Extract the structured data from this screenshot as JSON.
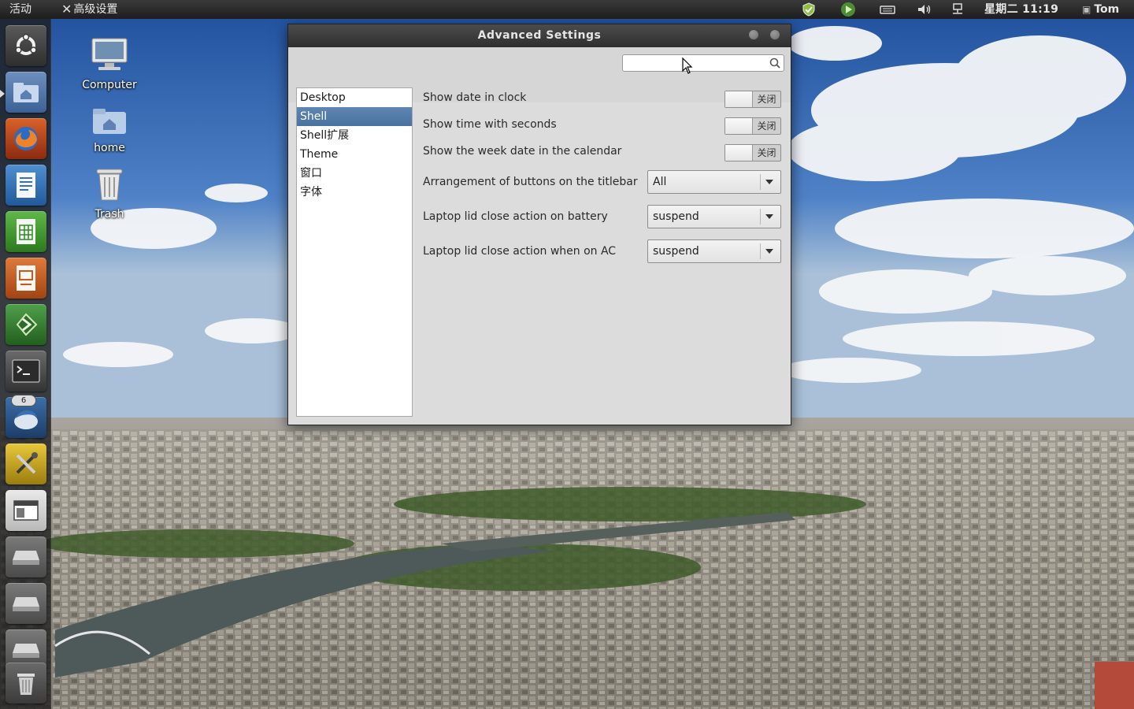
{
  "top_panel": {
    "activities": "活动",
    "app_menu": "高级设置",
    "clock": "星期二 11:19",
    "user": "Tom"
  },
  "launcher": {
    "items": [
      {
        "icon": "ubuntu-logo-icon"
      },
      {
        "icon": "home-folder-icon"
      },
      {
        "icon": "firefox-icon"
      },
      {
        "icon": "writer-icon"
      },
      {
        "icon": "calc-icon"
      },
      {
        "icon": "impress-icon"
      },
      {
        "icon": "gedit-icon"
      },
      {
        "icon": "terminal-icon"
      },
      {
        "icon": "thunderbird-icon",
        "badge": "6"
      },
      {
        "icon": "tweak-tool-icon"
      },
      {
        "icon": "window-icon"
      },
      {
        "icon": "drive-icon"
      },
      {
        "icon": "drive-icon"
      },
      {
        "icon": "drive-icon"
      },
      {
        "icon": "trash-icon"
      }
    ]
  },
  "desktop": {
    "icons": [
      {
        "label": "Computer"
      },
      {
        "label": "home"
      },
      {
        "label": "Trash"
      }
    ]
  },
  "window": {
    "title": "Advanced Settings",
    "search": {
      "value": "",
      "placeholder": ""
    },
    "sidebar": {
      "items": [
        {
          "label": "Desktop"
        },
        {
          "label": "Shell"
        },
        {
          "label": "Shell扩展"
        },
        {
          "label": "Theme"
        },
        {
          "label": "窗口"
        },
        {
          "label": "字体"
        }
      ],
      "selected": "Shell"
    },
    "settings": {
      "show_date": {
        "label": "Show date in clock",
        "state": "关闭"
      },
      "show_seconds": {
        "label": "Show time with seconds",
        "state": "关闭"
      },
      "week_date": {
        "label": "Show the week date in the calendar",
        "state": "关闭"
      },
      "titlebar_buttons": {
        "label": "Arrangement of buttons on the titlebar",
        "value": "All"
      },
      "lid_battery": {
        "label": "Laptop lid close action on battery",
        "value": "suspend"
      },
      "lid_ac": {
        "label": "Laptop lid close action when on AC",
        "value": "suspend"
      }
    }
  },
  "colors": {
    "panel": "#2b2b2b",
    "selection": "#5579a6",
    "window_bg": "#dcdcdc"
  }
}
